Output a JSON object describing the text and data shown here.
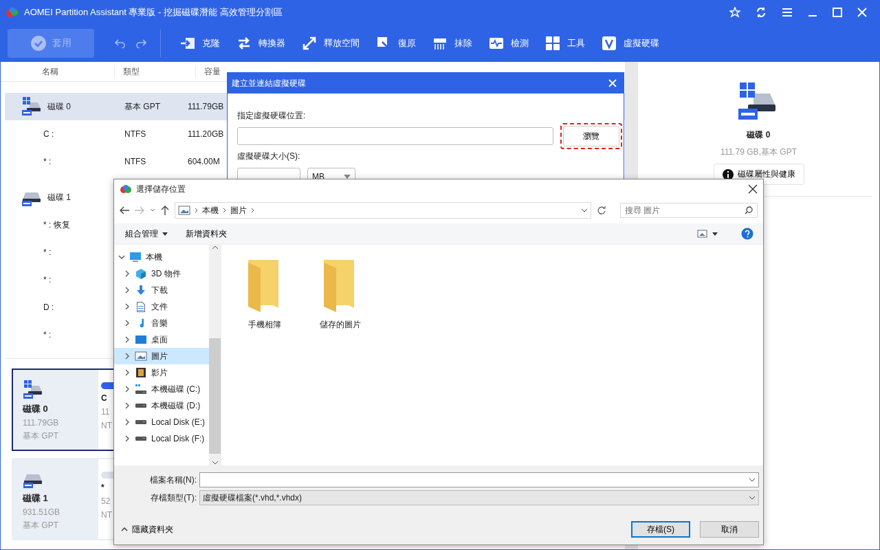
{
  "window": {
    "title": "AOMEI Partition Assistant 專業版 - 挖掘磁碟潛能 高效管理分割區"
  },
  "toolbar": {
    "apply": {
      "label": "套用",
      "disabled": true
    },
    "tools": [
      {
        "kind": "clone",
        "label": "克隆"
      },
      {
        "kind": "convert",
        "label": "轉換器"
      },
      {
        "kind": "free",
        "label": "釋放空間"
      },
      {
        "kind": "recover",
        "label": "復原"
      },
      {
        "kind": "wipe",
        "label": "抹除"
      },
      {
        "kind": "test",
        "label": "檢測"
      },
      {
        "kind": "tools",
        "label": "工具"
      },
      {
        "kind": "vdisk",
        "label": "虛擬硬碟"
      }
    ]
  },
  "disk_list": {
    "columns": [
      "名稱",
      "類型",
      "容量"
    ],
    "rows": [
      {
        "kind": "ssd",
        "name": "磁碟 0",
        "type": "基本 GPT",
        "capacity": "111.79GB",
        "selected": true
      },
      {
        "kind": "partition",
        "name": "C :",
        "type": "NTFS",
        "capacity": "111.20GB",
        "selected": false
      },
      {
        "kind": "partition",
        "name": "* :",
        "type": "NTFS",
        "capacity": "604.00M",
        "selected": false
      },
      {
        "kind": "hdd",
        "name": "磁碟 1",
        "selected": false
      },
      {
        "kind": "partition",
        "name": "* : 恢复",
        "selected": false
      },
      {
        "kind": "partition",
        "name": "* :",
        "selected": false
      },
      {
        "kind": "partition",
        "name": "* :",
        "selected": false
      },
      {
        "kind": "partition",
        "name": "D :",
        "selected": false
      },
      {
        "kind": "partition",
        "name": "* :",
        "selected": false
      }
    ]
  },
  "disk_cards": [
    {
      "kind": "ssd",
      "name": "磁碟 0",
      "size": "111.79GB",
      "type": "基本 GPT",
      "selected": true,
      "partition": {
        "color": "#2f63e6",
        "name": "C",
        "size": "11",
        "fs": "NT"
      }
    },
    {
      "kind": "hdd",
      "name": "磁碟 1",
      "size": "931.51GB",
      "type": "基本 GPT",
      "selected": false,
      "partition": {
        "color": "#dde3ee",
        "name": "*",
        "size": "52",
        "fs": "NT"
      }
    }
  ],
  "detail_panel": {
    "kind": "ssd",
    "name": "磁碟 0",
    "info": "111.79 GB,基本 GPT",
    "button": "磁碟屬性與健康"
  },
  "vdisk_dialog": {
    "title": "建立並連結虛擬硬碟",
    "location_label": "指定虛擬硬碟位置:",
    "browse": {
      "label": "瀏覽",
      "highlighted": true
    },
    "size_label": "虛擬硬碟大小(S):",
    "unit": "MB"
  },
  "save_dialog": {
    "title": "選擇儲存位置",
    "path": [
      "本機",
      "圖片"
    ],
    "search_placeholder": "搜尋 圖片",
    "organize": "組合管理",
    "new_folder": "新增資料夾",
    "tree": [
      {
        "kind": "pc",
        "label": "本機",
        "expanded": true,
        "selected": false,
        "children": [
          {
            "kind": "cube",
            "label": "3D 物件",
            "selected": false
          },
          {
            "kind": "download",
            "label": "下載",
            "selected": false
          },
          {
            "kind": "doc",
            "label": "文件",
            "selected": false
          },
          {
            "kind": "music",
            "label": "音樂",
            "selected": false
          },
          {
            "kind": "desktop",
            "label": "桌面",
            "selected": false
          },
          {
            "kind": "pictures",
            "label": "圖片",
            "selected": true
          },
          {
            "kind": "videos",
            "label": "影片",
            "selected": false
          },
          {
            "kind": "osdrive",
            "label": "本機磁碟 (C:)",
            "selected": false
          },
          {
            "kind": "drive",
            "label": "本機磁碟 (D:)",
            "selected": false
          },
          {
            "kind": "drive",
            "label": "Local Disk (E:)",
            "selected": false
          },
          {
            "kind": "drive",
            "label": "Local Disk (F:)",
            "selected": false
          }
        ]
      }
    ],
    "folders": [
      "手機相簿",
      "儲存的圖片"
    ],
    "filename_label": "檔案名稱(N):",
    "filetype_label": "存檔類型(T):",
    "filetype": "虛擬硬碟檔案(*.vhd,*.vhdx)",
    "hide_folders": "隱藏資料夾",
    "save": "存檔(S)",
    "cancel": "取消"
  }
}
